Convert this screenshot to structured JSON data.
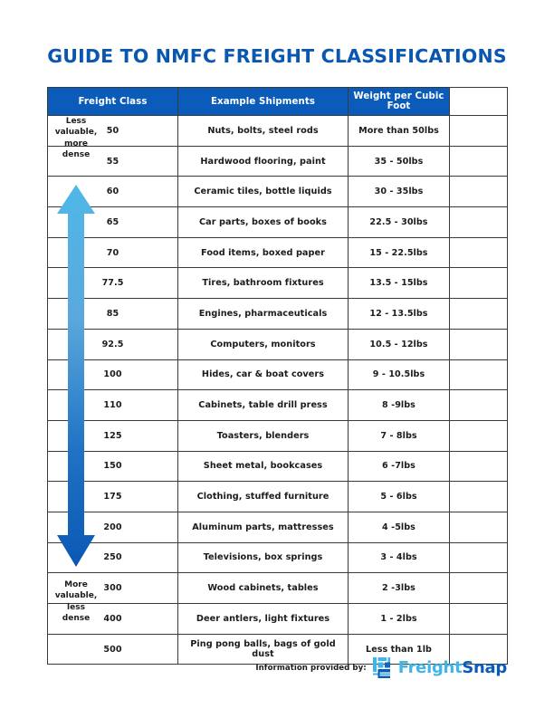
{
  "page": {
    "title": "GUIDE TO NMFC FREIGHT CLASSIFICATIONS",
    "accent_blue": "#0b5cba",
    "title_blue": "#0a57b0",
    "arrow_light": "#41b6e6",
    "arrow_dark": "#0b5cba"
  },
  "table": {
    "headers": [
      "Freight Class",
      "Example Shipments",
      "Weight per Cubic Foot",
      ""
    ],
    "rows": [
      {
        "freight_class": "50",
        "example_shipments": "Nuts, bolts, steel rods",
        "weight_per_cubic_foot": "More than 50lbs"
      },
      {
        "freight_class": "55",
        "example_shipments": "Hardwood flooring, paint",
        "weight_per_cubic_foot": "35 - 50lbs"
      },
      {
        "freight_class": "60",
        "example_shipments": "Ceramic tiles, bottle liquids",
        "weight_per_cubic_foot": "30 - 35lbs"
      },
      {
        "freight_class": "65",
        "example_shipments": "Car parts, boxes of books",
        "weight_per_cubic_foot": "22.5 - 30lbs"
      },
      {
        "freight_class": "70",
        "example_shipments": "Food items, boxed paper",
        "weight_per_cubic_foot": "15 - 22.5lbs"
      },
      {
        "freight_class": "77.5",
        "example_shipments": "Tires, bathroom fixtures",
        "weight_per_cubic_foot": "13.5 - 15lbs"
      },
      {
        "freight_class": "85",
        "example_shipments": "Engines, pharmaceuticals",
        "weight_per_cubic_foot": "12 - 13.5lbs"
      },
      {
        "freight_class": "92.5",
        "example_shipments": "Computers, monitors",
        "weight_per_cubic_foot": "10.5 - 12lbs"
      },
      {
        "freight_class": "100",
        "example_shipments": "Hides, car & boat covers",
        "weight_per_cubic_foot": "9 - 10.5lbs"
      },
      {
        "freight_class": "110",
        "example_shipments": "Cabinets, table drill press",
        "weight_per_cubic_foot": "8 -9lbs"
      },
      {
        "freight_class": "125",
        "example_shipments": "Toasters, blenders",
        "weight_per_cubic_foot": "7 - 8lbs"
      },
      {
        "freight_class": "150",
        "example_shipments": "Sheet metal, bookcases",
        "weight_per_cubic_foot": "6 -7lbs"
      },
      {
        "freight_class": "175",
        "example_shipments": "Clothing, stuffed furniture",
        "weight_per_cubic_foot": "5 - 6lbs"
      },
      {
        "freight_class": "200",
        "example_shipments": "Aluminum parts, mattresses",
        "weight_per_cubic_foot": "4 -5lbs"
      },
      {
        "freight_class": "250",
        "example_shipments": "Televisions, box springs",
        "weight_per_cubic_foot": "3 - 4lbs"
      },
      {
        "freight_class": "300",
        "example_shipments": "Wood cabinets, tables",
        "weight_per_cubic_foot": "2 -3lbs"
      },
      {
        "freight_class": "400",
        "example_shipments": "Deer antlers, light fixtures",
        "weight_per_cubic_foot": "1 - 2lbs"
      },
      {
        "freight_class": "500",
        "example_shipments": "Ping pong balls, bags of gold dust",
        "weight_per_cubic_foot": "Less than 1lb"
      }
    ]
  },
  "scale": {
    "top_label": "Less\nvaluable,\nmore\ndense",
    "top_label_lines": [
      "Less",
      "valuable,",
      "more",
      "dense"
    ],
    "bottom_label_lines": [
      "More",
      "valuable,",
      "less",
      "dense"
    ],
    "icon": "double-headed-vertical-arrow"
  },
  "footer": {
    "credit_text": "Information provided by:",
    "brand_part1": "Freight",
    "brand_part2": "Snap",
    "logo_icon": "freightsnap-grid-logo"
  }
}
